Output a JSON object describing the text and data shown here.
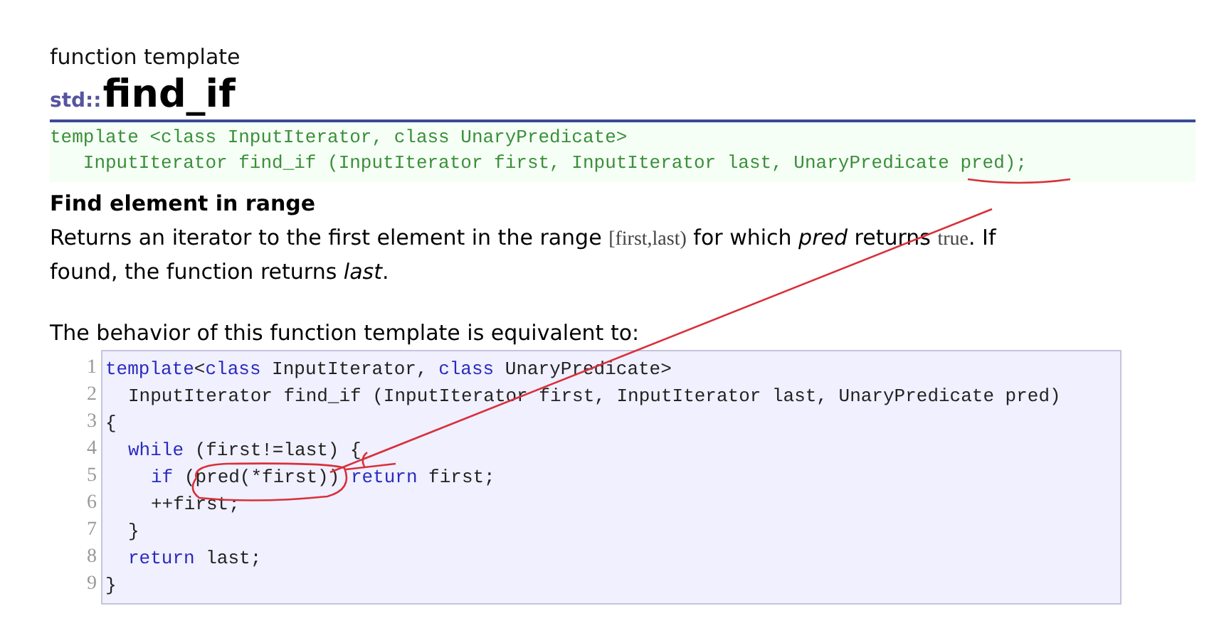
{
  "header": {
    "subtitle": "function template",
    "namespace": "std::",
    "name": "find_if"
  },
  "prototype": [
    "template <class InputIterator, class UnaryPredicate>",
    "   InputIterator find_if (InputIterator first, InputIterator last, UnaryPredicate pred);"
  ],
  "section_title": "Find element in range",
  "description": [
    [
      {
        "kind": "text",
        "text": "Returns an iterator to the first element in the range "
      },
      {
        "kind": "code",
        "text": "[first,last)"
      },
      {
        "kind": "text",
        "text": " for which *pred* returns "
      },
      {
        "kind": "code",
        "text": "true"
      },
      {
        "kind": "text",
        "text": ". If"
      }
    ],
    [
      {
        "kind": "text",
        "text": "found, the function returns *last*."
      }
    ]
  ],
  "equivalent_intro": "The behavior of this function template is equivalent to:",
  "code_lines": [
    {
      "number": "1",
      "tokens": [
        {
          "kind": "kw",
          "text": "template"
        },
        {
          "kind": "plain",
          "text": "<"
        },
        {
          "kind": "kw",
          "text": "class"
        },
        {
          "kind": "plain",
          "text": " InputIterator, "
        },
        {
          "kind": "kw",
          "text": "class"
        },
        {
          "kind": "plain",
          "text": " UnaryPredicate>"
        }
      ]
    },
    {
      "number": "2",
      "kind": "body",
      "tokens": [
        {
          "kind": "plain",
          "text": "InputIterator find_if (InputIterator first, InputIterator last, UnaryPredicate pred)"
        }
      ]
    },
    {
      "number": "3",
      "tokens": [
        {
          "kind": "plain",
          "text": "{"
        }
      ]
    },
    {
      "number": "4",
      "kind": "body",
      "tokens": [
        {
          "kind": "kw",
          "text": "while"
        },
        {
          "kind": "plain",
          "text": " (first!=last) {"
        }
      ]
    },
    {
      "number": "5",
      "kind": "inner",
      "tokens": [
        {
          "kind": "kw",
          "text": "if"
        },
        {
          "kind": "plain",
          "text": " (pred(*first)) "
        },
        {
          "kind": "kw",
          "text": "return"
        },
        {
          "kind": "plain",
          "text": " first;"
        }
      ]
    },
    {
      "number": "6",
      "kind": "inner",
      "tokens": [
        {
          "kind": "plain",
          "text": "++first;"
        }
      ]
    },
    {
      "number": "7",
      "kind": "body",
      "tokens": [
        {
          "kind": "plain",
          "text": "}"
        }
      ]
    },
    {
      "number": "8",
      "kind": "body",
      "tokens": [
        {
          "kind": "kw",
          "text": "return"
        },
        {
          "kind": "plain",
          "text": " last;"
        }
      ]
    },
    {
      "number": "9",
      "tokens": [
        {
          "kind": "plain",
          "text": "}"
        }
      ]
    }
  ]
}
